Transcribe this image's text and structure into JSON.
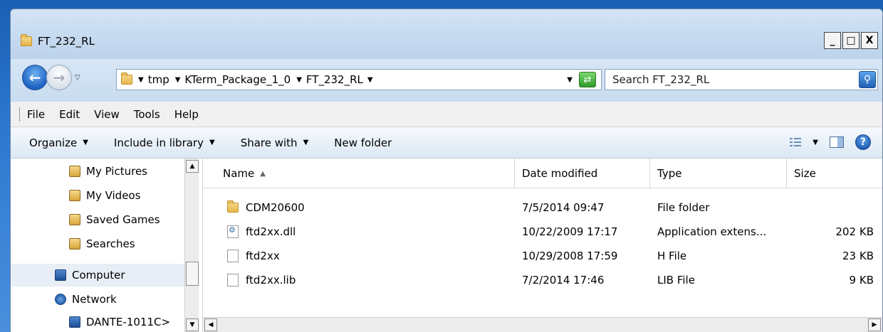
{
  "window": {
    "title": "FT_232_RL"
  },
  "window_controls": {
    "minimize": "_",
    "maximize": "□",
    "close": "X"
  },
  "address": {
    "breadcrumbs": [
      "tmp",
      "KTerm_Package_1_0",
      "FT_232_RL"
    ]
  },
  "search": {
    "placeholder": "Search FT_232_RL"
  },
  "menu": [
    "File",
    "Edit",
    "View",
    "Tools",
    "Help"
  ],
  "toolbar": {
    "organize": "Organize",
    "include": "Include in library",
    "share": "Share with",
    "new_folder": "New folder"
  },
  "nav_items": [
    {
      "label": "My Pictures",
      "icon": "pictures-folder-icon"
    },
    {
      "label": "My Videos",
      "icon": "videos-folder-icon"
    },
    {
      "label": "Saved Games",
      "icon": "games-folder-icon"
    },
    {
      "label": "Searches",
      "icon": "searches-folder-icon"
    },
    {
      "label": "Computer",
      "icon": "computer-icon"
    },
    {
      "label": "Network",
      "icon": "network-icon"
    },
    {
      "label": "DANTE-1011C>",
      "icon": "computer-icon"
    }
  ],
  "columns": {
    "name": "Name",
    "date": "Date modified",
    "type": "Type",
    "size": "Size"
  },
  "files": [
    {
      "name": "CDM20600",
      "date": "7/5/2014 09:47",
      "type": "File folder",
      "size": "",
      "icon": "folder-icon"
    },
    {
      "name": "ftd2xx.dll",
      "date": "10/22/2009 17:17",
      "type": "Application extens...",
      "size": "202 KB",
      "icon": "dll-file-icon"
    },
    {
      "name": "ftd2xx",
      "date": "10/29/2008 17:59",
      "type": "H File",
      "size": "23 KB",
      "icon": "text-file-icon"
    },
    {
      "name": "ftd2xx.lib",
      "date": "7/2/2014 17:46",
      "type": "LIB File",
      "size": "9 KB",
      "icon": "file-icon"
    }
  ]
}
